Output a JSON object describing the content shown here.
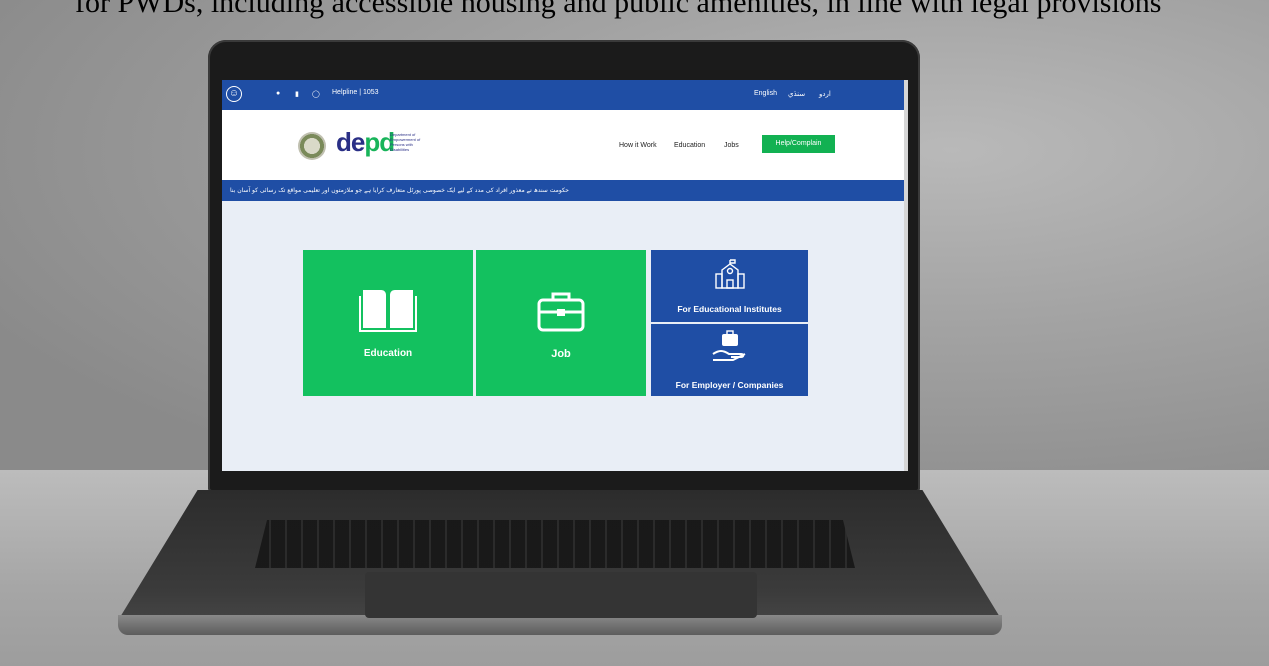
{
  "caption": "for PWDs, including accessible housing and public amenities, in line with legal provisions",
  "topbar": {
    "helpline": "Helpline | 1053",
    "languages": [
      "English",
      "سنڌي",
      "اردو"
    ],
    "icons": [
      "accessibility-icon",
      "facebook-icon",
      "youtube-icon",
      "instagram-icon"
    ]
  },
  "header": {
    "logo_text": "de",
    "logo_text_accent": "pd",
    "logo_sub": "Department of Empowerment of Persons with Disabilities",
    "nav": [
      "How it Work",
      "Education",
      "Jobs"
    ],
    "help_button": "Help/Complain"
  },
  "ticker": "حکومت سندھ نے معذور افراد کی مدد کے لیے ایک خصوصی پورٹل متعارف کرایا ہے جو ملازمتوں اور تعلیمی مواقع تک رسائی کو آسان بنا",
  "cards": {
    "education": "Education",
    "job": "Job",
    "institutes": "For Educational Institutes",
    "employers": "For Employer / Companies"
  },
  "colors": {
    "brand_blue": "#1f4ea5",
    "brand_green": "#13c15f"
  }
}
